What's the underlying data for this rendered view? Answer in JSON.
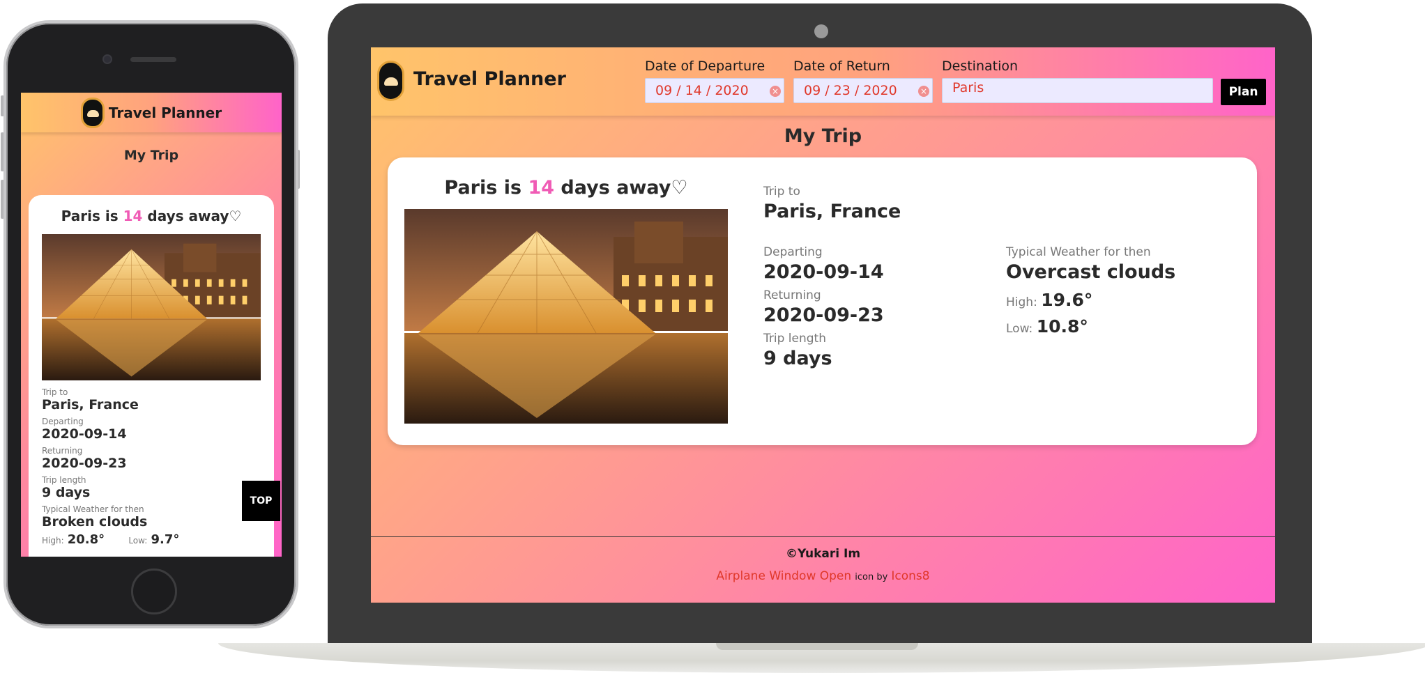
{
  "app": {
    "title": "Travel Planner",
    "gradient": [
      "#ffc46a",
      "#ff63c9"
    ],
    "accent": "#f05bb5",
    "link_color": "#e0382a"
  },
  "form": {
    "departure_label": "Date of Departure",
    "departure_value": "09 / 14 / 2020",
    "return_label": "Date of Return",
    "return_value": "09 / 23 / 2020",
    "destination_label": "Destination",
    "destination_value": "Paris",
    "plan_label": "Plan"
  },
  "section_title": "My Trip",
  "countdown": {
    "prefix": "Paris is ",
    "days": "14",
    "suffix": " days away",
    "heart": "♡"
  },
  "trip": {
    "trip_to_label": "Trip to",
    "trip_to": "Paris, France",
    "departing_label": "Departing",
    "departing": "2020-09-14",
    "returning_label": "Returning",
    "returning": "2020-09-23",
    "length_label": "Trip length",
    "length": "9 days"
  },
  "weather_desktop": {
    "label": "Typical Weather for then",
    "description": "Overcast clouds",
    "high_label": "High:",
    "high": "19.6°",
    "low_label": "Low:",
    "low": "10.8°"
  },
  "weather_mobile": {
    "label": "Typical Weather for then",
    "description": "Broken clouds",
    "high_label": "High:",
    "high": "20.8°",
    "low_label": "Low:",
    "low": "9.7°"
  },
  "top_button": "TOP",
  "footer": {
    "copyright": "©Yukari Im",
    "credit_link": "Airplane Window Open",
    "credit_mid": "icon by",
    "credit_source": "Icons8"
  }
}
